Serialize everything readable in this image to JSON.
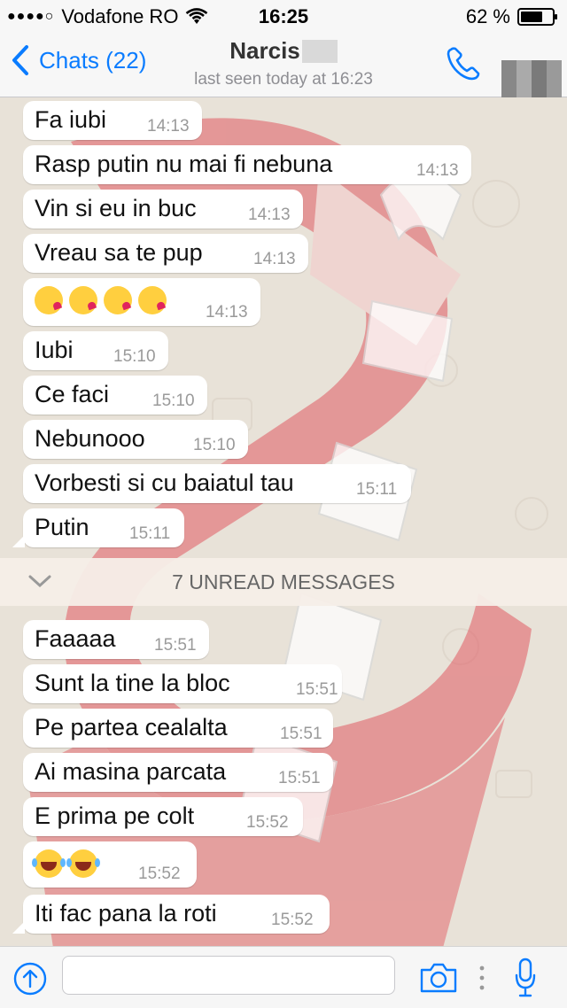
{
  "status_bar": {
    "carrier": "Vodafone RO",
    "signal": "●●●●○",
    "time": "16:25",
    "battery": "62 %"
  },
  "nav": {
    "back_label": "Chats (22)",
    "contact_name": "Narcis",
    "last_seen": "last seen today at 16:23"
  },
  "messages": [
    {
      "text": "Fa iubi",
      "time": "14:13"
    },
    {
      "text": "Rasp putin nu mai fi nebuna",
      "time": "14:13"
    },
    {
      "text": "Vin si eu in buc",
      "time": "14:13"
    },
    {
      "text": "Vreau sa te pup",
      "time": "14:13"
    },
    {
      "text": "",
      "emoji": "kissing-heart",
      "emoji_count": 4,
      "time": "14:13"
    },
    {
      "text": "Iubi",
      "time": "15:10"
    },
    {
      "text": "Ce faci",
      "time": "15:10"
    },
    {
      "text": "Nebunooo",
      "time": "15:10"
    },
    {
      "text": "Vorbesti si cu baiatul tau",
      "time": "15:11"
    },
    {
      "text": "Putin",
      "time": "15:11"
    },
    {
      "text": "Faaaaa",
      "time": "15:51"
    },
    {
      "text": "Sunt la tine la bloc",
      "time": "15:51"
    },
    {
      "text": "Pe partea cealalta",
      "time": "15:51"
    },
    {
      "text": "Ai masina parcata",
      "time": "15:51"
    },
    {
      "text": "E prima pe colt",
      "time": "15:52"
    },
    {
      "text": "",
      "emoji": "tears-of-joy",
      "emoji_count": 2,
      "time": "15:52"
    },
    {
      "text": "Iti fac pana la roti",
      "time": "15:52"
    }
  ],
  "unread_banner": "7 UNREAD MESSAGES",
  "input": {
    "value": "",
    "placeholder": ""
  },
  "colors": {
    "accent": "#0a7cff",
    "bubble": "#ffffff",
    "chat_bg": "#e8e2d8",
    "watermark": "#e0474c"
  },
  "icons": [
    "back-chevron-icon",
    "phone-icon",
    "upload-arrow-icon",
    "camera-icon",
    "more-dots-icon",
    "microphone-icon",
    "wifi-icon",
    "battery-icon",
    "chevron-down-icon"
  ]
}
